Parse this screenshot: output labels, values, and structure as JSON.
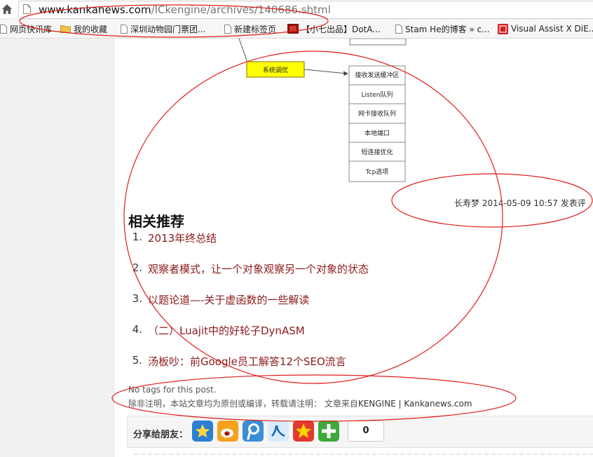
{
  "address_bar": {
    "url_host": "www.kankanews.com",
    "url_path": "/ICkengine/archives/140686.shtml"
  },
  "bookmarks": [
    {
      "label": "网页快讯库",
      "icon": "page-icon"
    },
    {
      "label": "我的收藏",
      "icon": "folder-icon"
    },
    {
      "label": "深圳动物园门票团...",
      "icon": "page-icon"
    },
    {
      "label": "新建标签页",
      "icon": "page-icon"
    },
    {
      "label": "【小七出品】DotA...",
      "icon": "dota-icon"
    },
    {
      "label": "Stam He的博客 » c...",
      "icon": "page-icon"
    },
    {
      "label": "Visual Assist X DiE...",
      "icon": "red-seal-icon"
    }
  ],
  "diagram": {
    "center_node": "系统调优",
    "nodes": [
      "接收发送缓冲区",
      "Listen队列",
      "网卡接收队列",
      "本地端口",
      "短连接优化",
      "Tcp选项"
    ]
  },
  "post_meta": {
    "text": "长寿梦 2014-05-09 10:57 发表评"
  },
  "related": {
    "title": "相关推荐",
    "items": [
      {
        "num": "1.",
        "label": "2013年终总结"
      },
      {
        "num": "2.",
        "label": "观察者模式，让一个对象观察另一个对象的状态"
      },
      {
        "num": "3.",
        "label": "以题论道—-关于虚函数的一些解读"
      },
      {
        "num": "4.",
        "label": "（二）Luajit中的好轮子DynASM"
      },
      {
        "num": "5.",
        "label": "汤板吵：前Google员工解答12个SEO流言"
      }
    ]
  },
  "tags_text": "No tags for this post.",
  "notice": {
    "text": "除非注明，本站文章均为原创或编译，转载请注明： 文章来自",
    "source": "KENGINE | Kankanews.com"
  },
  "share": {
    "label": "分享给朋友：",
    "icons": [
      "qzone-icon",
      "weibo-icon",
      "tencent-weibo-icon",
      "renren-icon",
      "kaixin-icon",
      "more-share-icon"
    ],
    "count": "0"
  },
  "colors": {
    "link": "#8b1a1a",
    "annotation": "#e01b1b",
    "node_highlight": "#ffff00"
  }
}
